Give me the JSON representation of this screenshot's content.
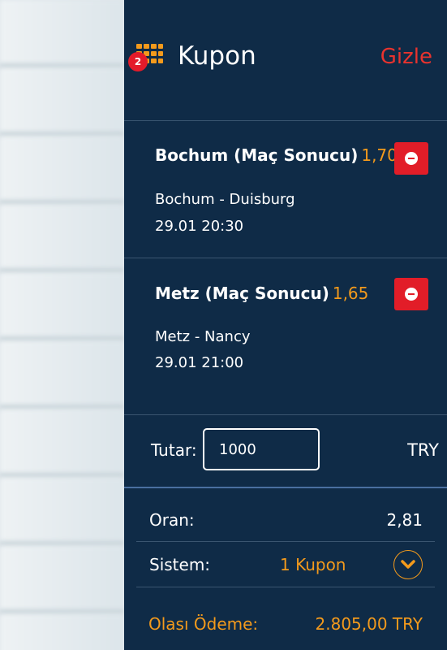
{
  "background_list": [],
  "header": {
    "badge_count": "2",
    "title": "Kupon",
    "hide_label": "Gizle"
  },
  "bets": [
    {
      "selection": "Bochum (Maç Sonucu)",
      "odd": "1,70",
      "match": "Bochum - Duisburg",
      "time": "29.01 20:30"
    },
    {
      "selection": "Metz (Maç Sonucu)",
      "odd": "1,65",
      "match": "Metz - Nancy",
      "time": "29.01 21:00"
    }
  ],
  "stake": {
    "label": "Tutar:",
    "value": "1000",
    "currency": "TRY"
  },
  "summary": {
    "odds_label": "Oran:",
    "odds_value": "2,81",
    "system_label": "Sistem:",
    "system_value": "1 Kupon",
    "payout_label": "Olası Ödeme:",
    "payout_value": "2.805,00 TRY"
  },
  "colors": {
    "panel": "#0f2b47",
    "accent": "#f39a1c",
    "danger": "#e21d28"
  }
}
